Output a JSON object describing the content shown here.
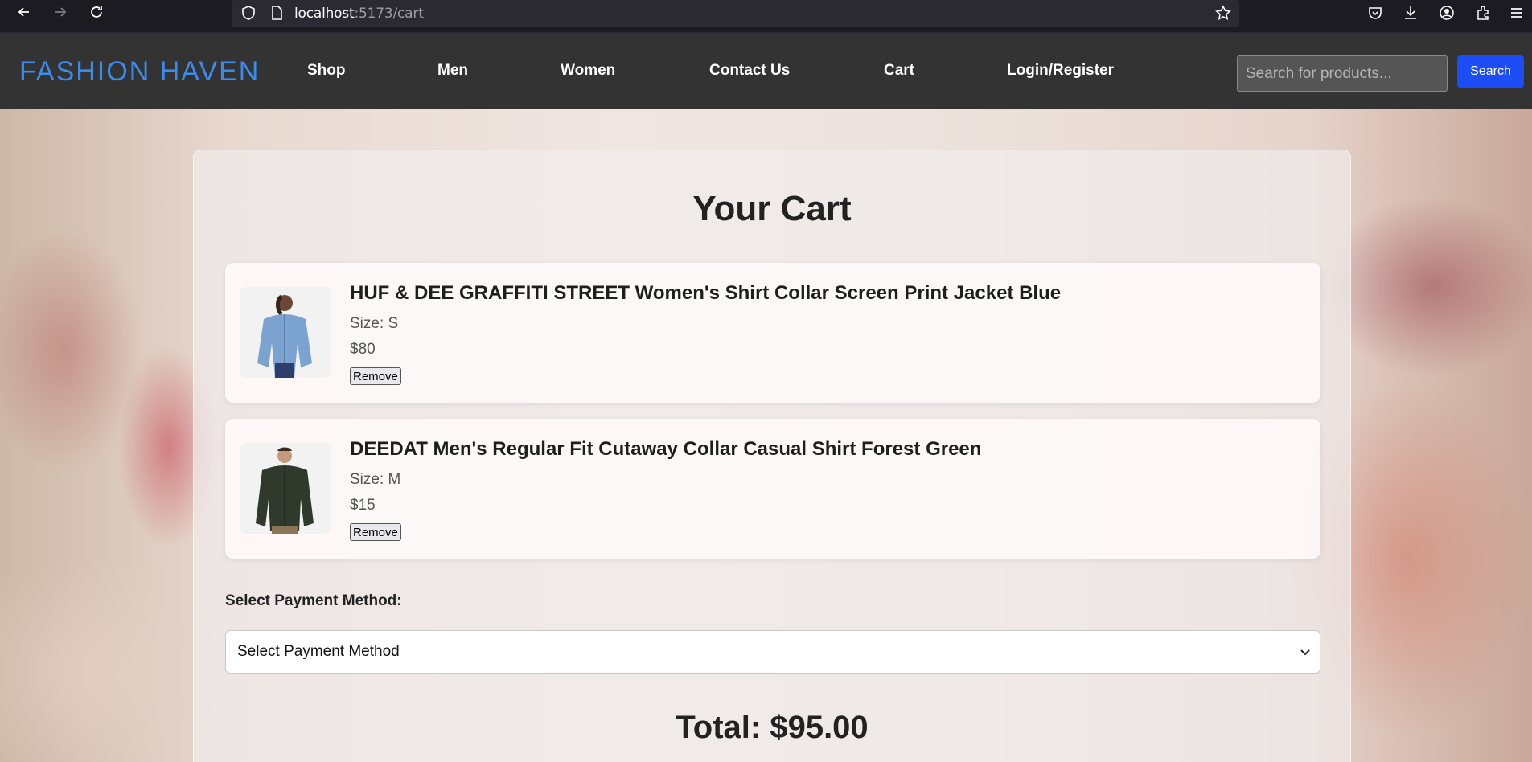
{
  "browser": {
    "url_host": "localhost",
    "url_path": ":5173/cart"
  },
  "header": {
    "brand": "FASHION HAVEN",
    "nav": [
      {
        "label": "Shop"
      },
      {
        "label": "Men"
      },
      {
        "label": "Women"
      },
      {
        "label": "Contact Us"
      },
      {
        "label": "Cart"
      },
      {
        "label": "Login/Register"
      }
    ],
    "search_placeholder": "Search for products...",
    "search_button": "Search"
  },
  "cart": {
    "title": "Your Cart",
    "items": [
      {
        "name": "HUF & DEE GRAFFITI STREET Women's Shirt Collar Screen Print Jacket Blue",
        "size": "Size: S",
        "price": "$80",
        "remove_label": "Remove",
        "image_icon": "denim-jacket-image"
      },
      {
        "name": "DEEDAT Men's Regular Fit Cutaway Collar Casual Shirt Forest Green",
        "size": "Size: M",
        "price": "$15",
        "remove_label": "Remove",
        "image_icon": "green-shirt-image"
      }
    ],
    "payment_label": "Select Payment Method:",
    "payment_selected": "Select Payment Method",
    "total": "Total: $95.00"
  },
  "colors": {
    "header_bg": "#333333",
    "brand": "#3b8beb",
    "search_button": "#1d4ef5"
  }
}
